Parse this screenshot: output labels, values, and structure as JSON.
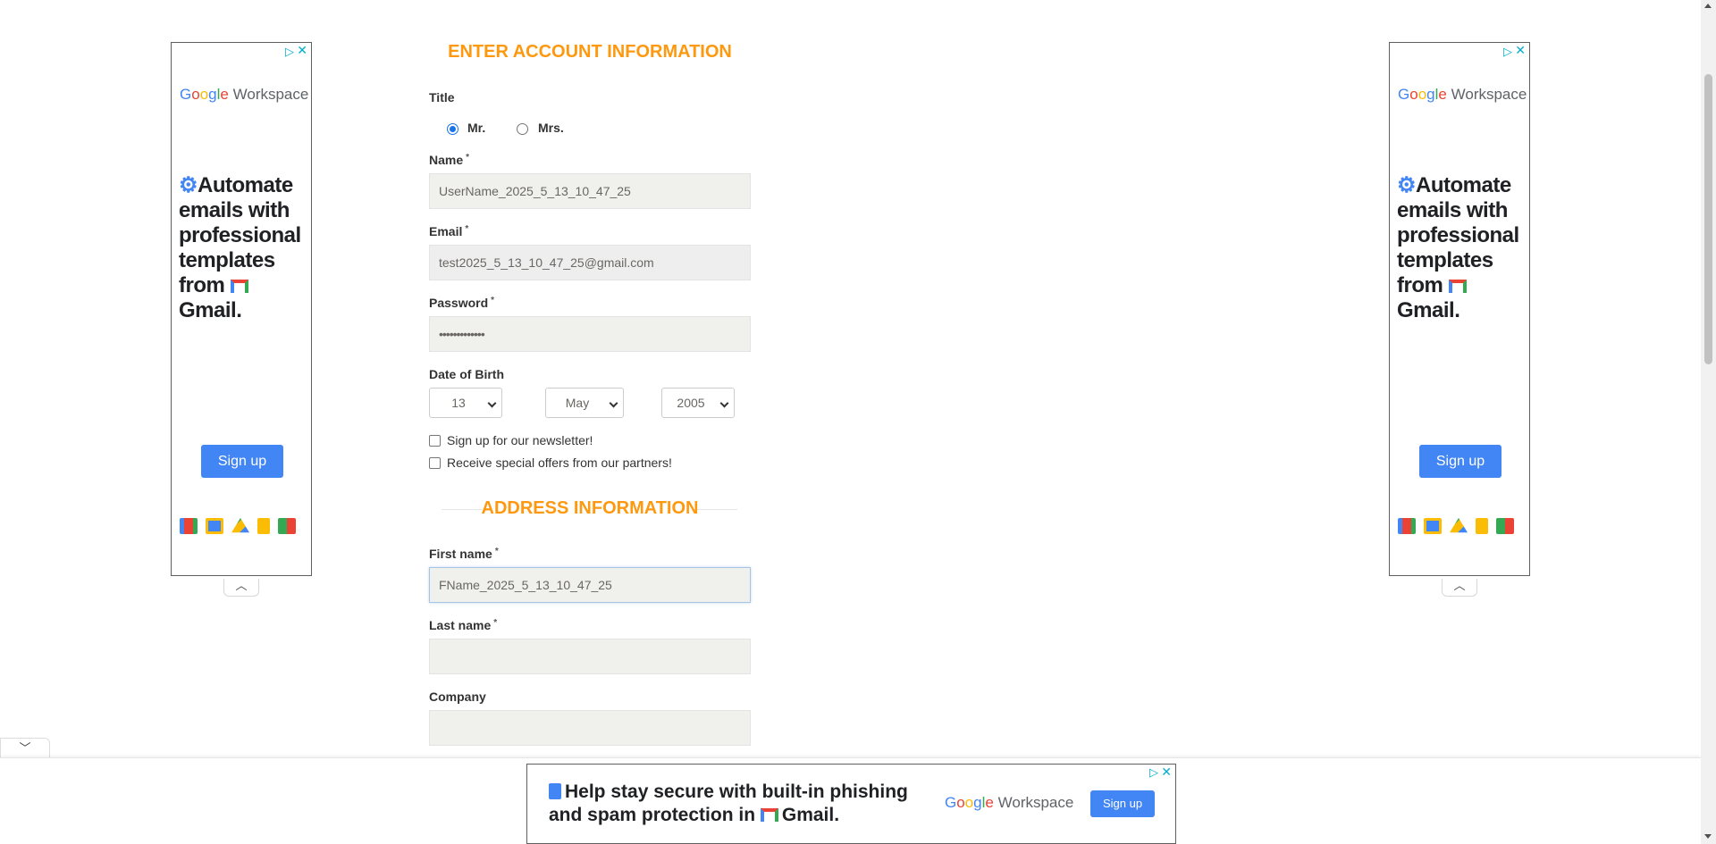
{
  "ads": {
    "side": {
      "brand_google": [
        "G",
        "o",
        "o",
        "g",
        "l",
        "e"
      ],
      "brand_workspace": "Workspace",
      "headline_prefix": "Automate emails with professional templates from",
      "headline_gmail": "Gmail.",
      "signup": "Sign up",
      "adchoices_icon": "▷",
      "close_icon": "✕",
      "collapse_icon": "︿"
    },
    "bottom": {
      "headline_1": "Help stay secure with built-in phishing",
      "headline_2": "and spam protection in",
      "headline_gmail": "Gmail.",
      "brand_workspace": "Workspace",
      "signup": "Sign up",
      "expand_icon": "﹀"
    }
  },
  "account": {
    "section_title": "ENTER ACCOUNT INFORMATION",
    "title_label": "Title",
    "title_options": [
      {
        "label": "Mr.",
        "selected": true
      },
      {
        "label": "Mrs.",
        "selected": false
      }
    ],
    "name_label": "Name",
    "name_value": "UserName_2025_5_13_10_47_25",
    "email_label": "Email",
    "email_value": "test2025_5_13_10_47_25@gmail.com",
    "password_label": "Password",
    "password_value": "•••••••••••••",
    "dob_label": "Date of Birth",
    "dob_day": "13",
    "dob_month": "May",
    "dob_year": "2005",
    "newsletter_label": "Sign up for our newsletter!",
    "offers_label": "Receive special offers from our partners!",
    "required_mark": "*"
  },
  "address": {
    "section_title": "ADDRESS INFORMATION",
    "first_name_label": "First name",
    "first_name_value": "FName_2025_5_13_10_47_25",
    "last_name_label": "Last name",
    "last_name_value": "",
    "company_label": "Company",
    "company_value": ""
  },
  "colors": {
    "section_title": "#fe980f",
    "ad_button": "#4285f4",
    "field_bg": "#f0f0ed"
  }
}
